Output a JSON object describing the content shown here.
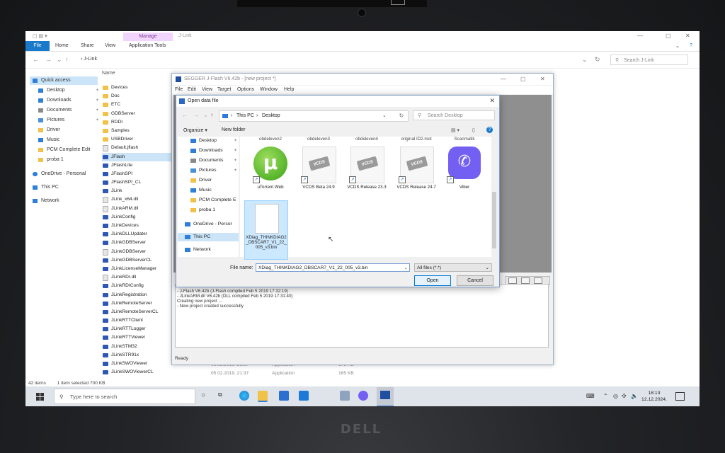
{
  "explorer": {
    "title": "J-Link",
    "manage_tab": "Manage",
    "ribbon_tabs": [
      "File",
      "Home",
      "Share",
      "View",
      "Application Tools"
    ],
    "address": "J-Link",
    "search_placeholder": "Search J-Link",
    "column_name": "Name",
    "nav": [
      {
        "label": "Quick access",
        "color": "#2f7fd8"
      },
      {
        "label": "Desktop",
        "color": "#2f7fd8"
      },
      {
        "label": "Downloads",
        "color": "#2f7fd8"
      },
      {
        "label": "Documents",
        "color": "#8a8a8a"
      },
      {
        "label": "Pictures",
        "color": "#4a90d9"
      },
      {
        "label": "Driver",
        "color": "#f0c24a"
      },
      {
        "label": "Music",
        "color": "#2f7fd8"
      },
      {
        "label": "PCM Complete Edit",
        "color": "#f0c24a"
      },
      {
        "label": "proba 1",
        "color": "#f0c24a"
      },
      {
        "label": "OneDrive - Personal",
        "color": "#2f7fd8"
      },
      {
        "label": "This PC",
        "color": "#2f7fd8"
      },
      {
        "label": "Network",
        "color": "#2f7fd8"
      }
    ],
    "files": [
      {
        "name": "Devices",
        "kind": "folder"
      },
      {
        "name": "Doc",
        "kind": "folder"
      },
      {
        "name": "ETC",
        "kind": "folder"
      },
      {
        "name": "GDBServer",
        "kind": "folder"
      },
      {
        "name": "RDDI",
        "kind": "folder"
      },
      {
        "name": "Samples",
        "kind": "folder"
      },
      {
        "name": "USBDriver",
        "kind": "folder"
      },
      {
        "name": "Default.jflash",
        "kind": "dll"
      },
      {
        "name": "JFlash",
        "kind": "app"
      },
      {
        "name": "JFlashLite",
        "kind": "app"
      },
      {
        "name": "JFlashSPI",
        "kind": "app"
      },
      {
        "name": "JFlashSPI_CL",
        "kind": "app"
      },
      {
        "name": "JLink",
        "kind": "app"
      },
      {
        "name": "JLink_x64.dll",
        "kind": "dll"
      },
      {
        "name": "JLinkARM.dll",
        "kind": "dll"
      },
      {
        "name": "JLinkConfig",
        "kind": "app"
      },
      {
        "name": "JLinkDevices",
        "kind": "app"
      },
      {
        "name": "JLinkDLLUpdater",
        "kind": "app"
      },
      {
        "name": "JLinkGDBServer",
        "kind": "app"
      },
      {
        "name": "JLinkGDBServer",
        "kind": "dll"
      },
      {
        "name": "JLinkGDBServerCL",
        "kind": "app"
      },
      {
        "name": "JLinkLicenseManager",
        "kind": "app"
      },
      {
        "name": "JLinkRDI.dll",
        "kind": "dll"
      },
      {
        "name": "JLinkRDIConfig",
        "kind": "app"
      },
      {
        "name": "JLinkRegistration",
        "kind": "app"
      },
      {
        "name": "JLinkRemoteServer",
        "kind": "app"
      },
      {
        "name": "JLinkRemoteServerCL",
        "kind": "app"
      },
      {
        "name": "JLinkRTTClient",
        "kind": "app"
      },
      {
        "name": "JLinkRTTLogger",
        "kind": "app"
      },
      {
        "name": "JLinkRTTViewer",
        "kind": "app"
      },
      {
        "name": "JLinkSTM32",
        "kind": "app"
      },
      {
        "name": "JLinkSTR91x",
        "kind": "app"
      },
      {
        "name": "JLinkSWOViewer",
        "kind": "app"
      },
      {
        "name": "JLinkSWOViewerCL",
        "kind": "app"
      }
    ],
    "bottom_rows": [
      {
        "date": "05.02.2019. 21:37",
        "type": "Application",
        "size": "178 KB"
      },
      {
        "date": "05.02.2019. 21:37",
        "type": "Application",
        "size": "165 KB"
      }
    ],
    "status_items": "42 items",
    "status_selected": "1 item selected  700 KB"
  },
  "jflash": {
    "title": "SEGGER J-Flash V6.42b - [new project *]",
    "menu": [
      "File",
      "Edit",
      "View",
      "Target",
      "Options",
      "Window",
      "Help"
    ],
    "log": [
      "- J-Flash V6.42b (J-Flash compiled Feb  5 2019 17:32:19)",
      "- JLinkARM.dll V6.42b (DLL compiled Feb  5 2019 17:31:40)",
      "Creating new project ...",
      " - New project created successfully"
    ],
    "status": "Ready"
  },
  "dialog": {
    "title": "Open data file",
    "path": [
      "This PC",
      "Desktop"
    ],
    "search_placeholder": "Search Desktop",
    "organize": "Organize ▾",
    "new_folder": "New folder",
    "left_items": [
      {
        "label": "Desktop",
        "color": "#2f7fd8",
        "pin": true
      },
      {
        "label": "Downloads",
        "color": "#2f7fd8",
        "pin": true
      },
      {
        "label": "Documents",
        "color": "#8a8a8a",
        "pin": true
      },
      {
        "label": "Pictures",
        "color": "#4a90d9",
        "pin": true
      },
      {
        "label": "Driver",
        "color": "#f0c24a",
        "pin": false
      },
      {
        "label": "Music",
        "color": "#2f7fd8",
        "pin": false
      },
      {
        "label": "PCM Complete E",
        "color": "#f0c24a",
        "pin": false
      },
      {
        "label": "proba 1",
        "color": "#f0c24a",
        "pin": false
      },
      {
        "label": "OneDrive - Persor",
        "color": "#2f7fd8",
        "pin": false
      },
      {
        "label": "This PC",
        "color": "#2f7fd8",
        "pin": false
      },
      {
        "label": "Network",
        "color": "#2f7fd8",
        "pin": false
      }
    ],
    "top_labels": [
      "obdeleven2",
      "obdeleven3",
      "obdeleven4",
      "original ID2.mot",
      "Scanmatik"
    ],
    "tiles": [
      {
        "label": "uTorrent Web",
        "icon": "utorrent-icon"
      },
      {
        "label": "VCDS Beta 24.9",
        "icon": "vcds-icon",
        "badge": "VCDS"
      },
      {
        "label": "VCDS Release 23.3",
        "icon": "vcds-icon",
        "badge": "VCDS"
      },
      {
        "label": "VCDS Release 24.7",
        "icon": "vcds-icon",
        "badge": "VCDS"
      },
      {
        "label": "Viber",
        "icon": "viber-icon"
      }
    ],
    "selected_file": "XDiag_THINKDIAG2_DBSCAR7_V1_22_005_v3.bin",
    "filename_label": "File name:",
    "filename_value": "XDiag_THINKDIAG2_DBSCAR7_V1_22_005_v3.bin",
    "filter": "All files (*.*)",
    "open_label": "Open",
    "cancel_label": "Cancel"
  },
  "taskbar": {
    "search_placeholder": "Type here to search",
    "time": "18:13",
    "date": "12.12.2024."
  },
  "brand": "DELL"
}
